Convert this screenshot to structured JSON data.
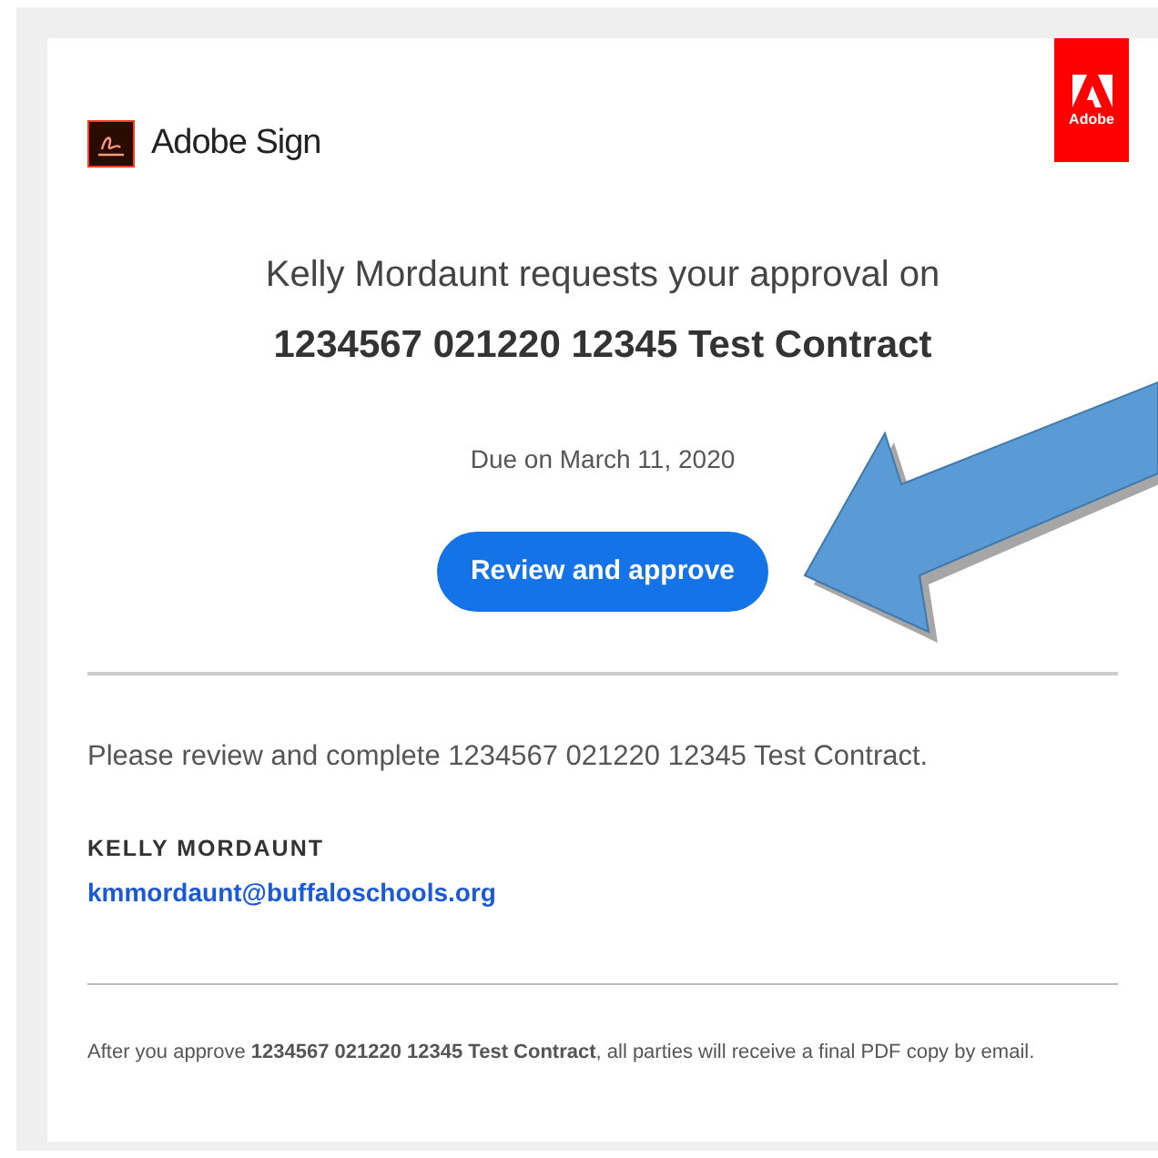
{
  "header": {
    "product_name": "Adobe Sign",
    "logo_text": "Adobe"
  },
  "request": {
    "line": "Kelly Mordaunt requests your approval on",
    "document": "1234567 021220 12345 Test Contract",
    "due": "Due on March 11, 2020",
    "button": "Review and approve"
  },
  "message": "Please review and complete 1234567 021220 12345 Test Contract.",
  "sender": {
    "name": "KELLY MORDAUNT",
    "email": "kmmordaunt@buffaloschools.org"
  },
  "footer": "After you approve **1234567 021220 12345 Test Contract**, all parties will receive a final PDF copy by email."
}
